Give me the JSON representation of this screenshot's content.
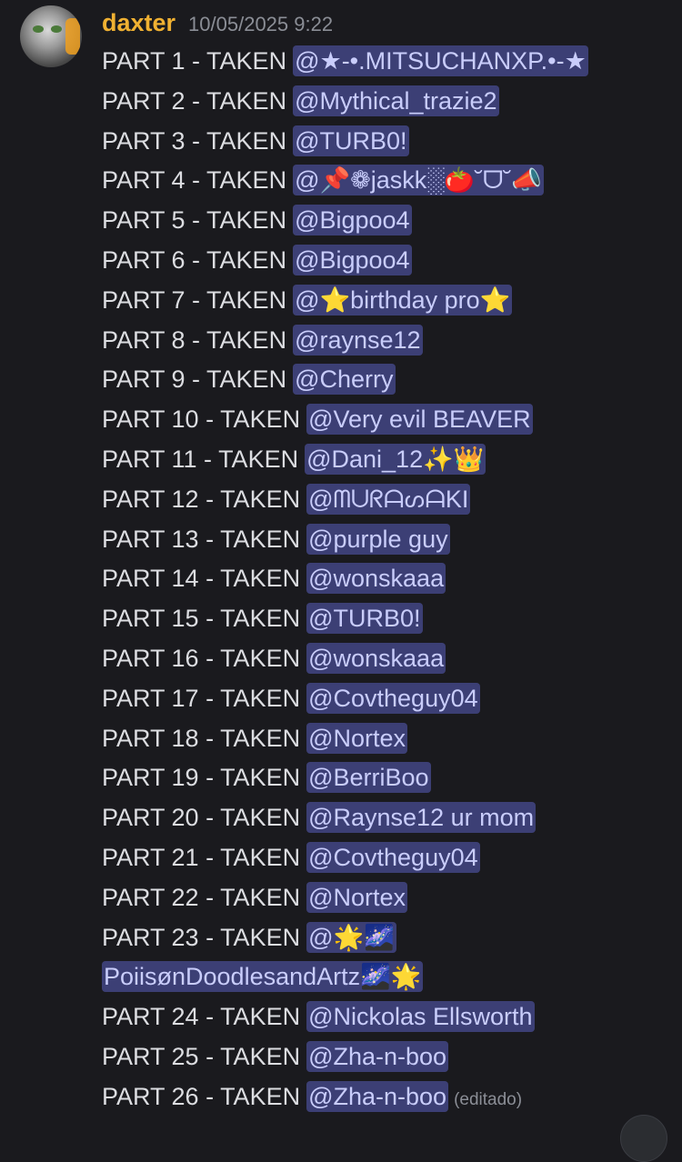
{
  "message": {
    "author": "daxter",
    "timestamp": "10/05/2025 9:22",
    "edited_label": "(editado)",
    "lines": [
      {
        "prefix": "PART 1 - TAKEN",
        "mention": "@★-•.MITSUCHANXP.•-★"
      },
      {
        "prefix": "PART 2 - TAKEN",
        "mention": "@Mythical_trazie2"
      },
      {
        "prefix": "PART 3 - TAKEN",
        "mention": "@TURB0!"
      },
      {
        "prefix": "PART 4 - TAKEN",
        "mention": "@📌❁jaskk░🍅˘ᗜ˘📣"
      },
      {
        "prefix": "PART 5 - TAKEN",
        "mention": "@Bigpoo4"
      },
      {
        "prefix": "PART 6 - TAKEN",
        "mention": "@Bigpoo4"
      },
      {
        "prefix": "PART 7 - TAKEN",
        "mention": "@⭐birthday pro⭐"
      },
      {
        "prefix": "PART 8 - TAKEN",
        "mention": "@raynse12"
      },
      {
        "prefix": "PART 9 - TAKEN",
        "mention": "@Cherry"
      },
      {
        "prefix": "PART 10 - TAKEN",
        "mention": "@Very evil BEAVER"
      },
      {
        "prefix": "PART 11 - TAKEN",
        "mention": "@Dani_12✨👑"
      },
      {
        "prefix": "PART 12 - TAKEN",
        "mention": "@ᗰᑌᖇᗩᔕᗩKI"
      },
      {
        "prefix": "PART 13 - TAKEN",
        "mention": "@purple guy"
      },
      {
        "prefix": "PART 14 - TAKEN",
        "mention": "@wonskaaa"
      },
      {
        "prefix": "PART 15 - TAKEN",
        "mention": "@TURB0!"
      },
      {
        "prefix": "PART 16 - TAKEN",
        "mention": "@wonskaaa"
      },
      {
        "prefix": "PART 17 - TAKEN",
        "mention": "@Covtheguy04"
      },
      {
        "prefix": "PART 18 - TAKEN",
        "mention": "@Nortex"
      },
      {
        "prefix": "PART 19 - TAKEN",
        "mention": "@BerriBoo"
      },
      {
        "prefix": "PART 20 - TAKEN",
        "mention": "@Raynse12 ur mom"
      },
      {
        "prefix": "PART 21 - TAKEN",
        "mention": "@Covtheguy04"
      },
      {
        "prefix": "PART 22 - TAKEN",
        "mention": "@Nortex"
      },
      {
        "prefix": "PART 23 - TAKEN",
        "mention": "@🌟🌌"
      },
      {
        "prefix": "",
        "mention": "PoiisønDoodlesandArtz🌌🌟"
      },
      {
        "prefix": "PART 24 - TAKEN",
        "mention": "@Nickolas Ellsworth"
      },
      {
        "prefix": "PART 25 - TAKEN",
        "mention": "@Zha-n-boo"
      },
      {
        "prefix": "PART 26 - TAKEN",
        "mention": "@Zha-n-boo"
      }
    ]
  }
}
